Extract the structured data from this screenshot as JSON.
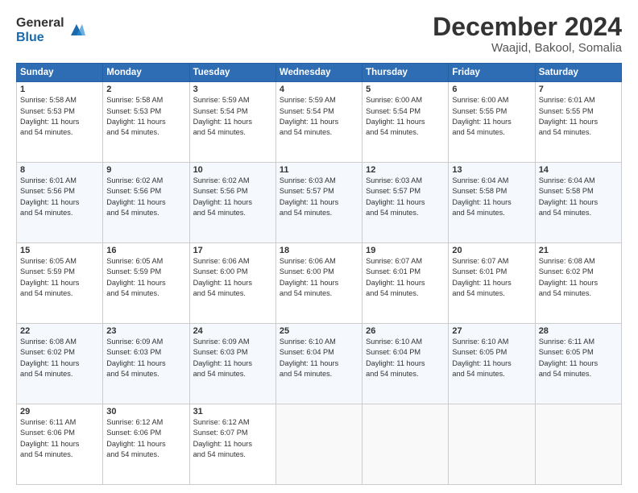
{
  "logo": {
    "general": "General",
    "blue": "Blue"
  },
  "title": "December 2024",
  "subtitle": "Waajid, Bakool, Somalia",
  "days_of_week": [
    "Sunday",
    "Monday",
    "Tuesday",
    "Wednesday",
    "Thursday",
    "Friday",
    "Saturday"
  ],
  "weeks": [
    [
      {
        "day": "1",
        "info": "Sunrise: 5:58 AM\nSunset: 5:53 PM\nDaylight: 11 hours\nand 54 minutes."
      },
      {
        "day": "2",
        "info": "Sunrise: 5:58 AM\nSunset: 5:53 PM\nDaylight: 11 hours\nand 54 minutes."
      },
      {
        "day": "3",
        "info": "Sunrise: 5:59 AM\nSunset: 5:54 PM\nDaylight: 11 hours\nand 54 minutes."
      },
      {
        "day": "4",
        "info": "Sunrise: 5:59 AM\nSunset: 5:54 PM\nDaylight: 11 hours\nand 54 minutes."
      },
      {
        "day": "5",
        "info": "Sunrise: 6:00 AM\nSunset: 5:54 PM\nDaylight: 11 hours\nand 54 minutes."
      },
      {
        "day": "6",
        "info": "Sunrise: 6:00 AM\nSunset: 5:55 PM\nDaylight: 11 hours\nand 54 minutes."
      },
      {
        "day": "7",
        "info": "Sunrise: 6:01 AM\nSunset: 5:55 PM\nDaylight: 11 hours\nand 54 minutes."
      }
    ],
    [
      {
        "day": "8",
        "info": "Sunrise: 6:01 AM\nSunset: 5:56 PM\nDaylight: 11 hours\nand 54 minutes."
      },
      {
        "day": "9",
        "info": "Sunrise: 6:02 AM\nSunset: 5:56 PM\nDaylight: 11 hours\nand 54 minutes."
      },
      {
        "day": "10",
        "info": "Sunrise: 6:02 AM\nSunset: 5:56 PM\nDaylight: 11 hours\nand 54 minutes."
      },
      {
        "day": "11",
        "info": "Sunrise: 6:03 AM\nSunset: 5:57 PM\nDaylight: 11 hours\nand 54 minutes."
      },
      {
        "day": "12",
        "info": "Sunrise: 6:03 AM\nSunset: 5:57 PM\nDaylight: 11 hours\nand 54 minutes."
      },
      {
        "day": "13",
        "info": "Sunrise: 6:04 AM\nSunset: 5:58 PM\nDaylight: 11 hours\nand 54 minutes."
      },
      {
        "day": "14",
        "info": "Sunrise: 6:04 AM\nSunset: 5:58 PM\nDaylight: 11 hours\nand 54 minutes."
      }
    ],
    [
      {
        "day": "15",
        "info": "Sunrise: 6:05 AM\nSunset: 5:59 PM\nDaylight: 11 hours\nand 54 minutes."
      },
      {
        "day": "16",
        "info": "Sunrise: 6:05 AM\nSunset: 5:59 PM\nDaylight: 11 hours\nand 54 minutes."
      },
      {
        "day": "17",
        "info": "Sunrise: 6:06 AM\nSunset: 6:00 PM\nDaylight: 11 hours\nand 54 minutes."
      },
      {
        "day": "18",
        "info": "Sunrise: 6:06 AM\nSunset: 6:00 PM\nDaylight: 11 hours\nand 54 minutes."
      },
      {
        "day": "19",
        "info": "Sunrise: 6:07 AM\nSunset: 6:01 PM\nDaylight: 11 hours\nand 54 minutes."
      },
      {
        "day": "20",
        "info": "Sunrise: 6:07 AM\nSunset: 6:01 PM\nDaylight: 11 hours\nand 54 minutes."
      },
      {
        "day": "21",
        "info": "Sunrise: 6:08 AM\nSunset: 6:02 PM\nDaylight: 11 hours\nand 54 minutes."
      }
    ],
    [
      {
        "day": "22",
        "info": "Sunrise: 6:08 AM\nSunset: 6:02 PM\nDaylight: 11 hours\nand 54 minutes."
      },
      {
        "day": "23",
        "info": "Sunrise: 6:09 AM\nSunset: 6:03 PM\nDaylight: 11 hours\nand 54 minutes."
      },
      {
        "day": "24",
        "info": "Sunrise: 6:09 AM\nSunset: 6:03 PM\nDaylight: 11 hours\nand 54 minutes."
      },
      {
        "day": "25",
        "info": "Sunrise: 6:10 AM\nSunset: 6:04 PM\nDaylight: 11 hours\nand 54 minutes."
      },
      {
        "day": "26",
        "info": "Sunrise: 6:10 AM\nSunset: 6:04 PM\nDaylight: 11 hours\nand 54 minutes."
      },
      {
        "day": "27",
        "info": "Sunrise: 6:10 AM\nSunset: 6:05 PM\nDaylight: 11 hours\nand 54 minutes."
      },
      {
        "day": "28",
        "info": "Sunrise: 6:11 AM\nSunset: 6:05 PM\nDaylight: 11 hours\nand 54 minutes."
      }
    ],
    [
      {
        "day": "29",
        "info": "Sunrise: 6:11 AM\nSunset: 6:06 PM\nDaylight: 11 hours\nand 54 minutes."
      },
      {
        "day": "30",
        "info": "Sunrise: 6:12 AM\nSunset: 6:06 PM\nDaylight: 11 hours\nand 54 minutes."
      },
      {
        "day": "31",
        "info": "Sunrise: 6:12 AM\nSunset: 6:07 PM\nDaylight: 11 hours\nand 54 minutes."
      },
      {
        "day": "",
        "info": ""
      },
      {
        "day": "",
        "info": ""
      },
      {
        "day": "",
        "info": ""
      },
      {
        "day": "",
        "info": ""
      }
    ]
  ]
}
